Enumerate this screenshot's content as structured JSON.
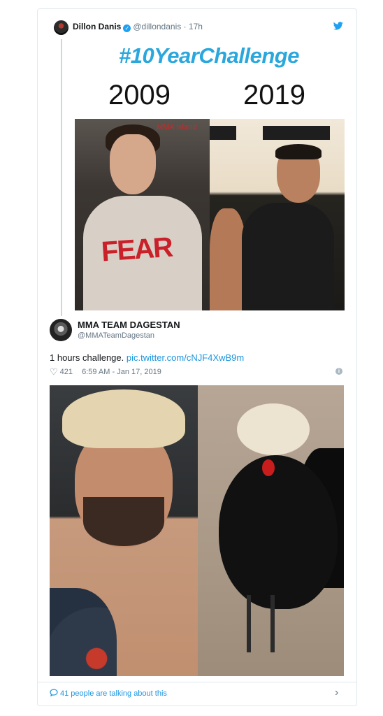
{
  "quoted_tweet": {
    "author_name": "Dillon Danis",
    "author_handle": "@dillondanis",
    "time": "· 17h",
    "image": {
      "title": "#10YearChallenge",
      "left_year": "2009",
      "right_year": "2019",
      "watermark": "MMA Island"
    }
  },
  "tweet": {
    "author_name": "MMA TEAM DAGESTAN",
    "author_handle": "@MMATeamDagestan",
    "text": "1 hours challenge.",
    "link": "pic.twitter.com/cNJF4XwB9m",
    "likes": "421",
    "timestamp": "6:59 AM - Jan 17, 2019"
  },
  "footer": {
    "talking": "41 people are talking about this"
  },
  "icons": {
    "verified": "verified-badge-icon",
    "twitter": "twitter-bird-icon",
    "heart": "heart-icon",
    "info": "info-icon",
    "comment": "comment-icon",
    "chevron": "chevron-right-icon"
  },
  "colors": {
    "accent": "#1da1f2",
    "link": "#1b95e0",
    "title": "#2aa7dd",
    "muted": "#657786"
  }
}
